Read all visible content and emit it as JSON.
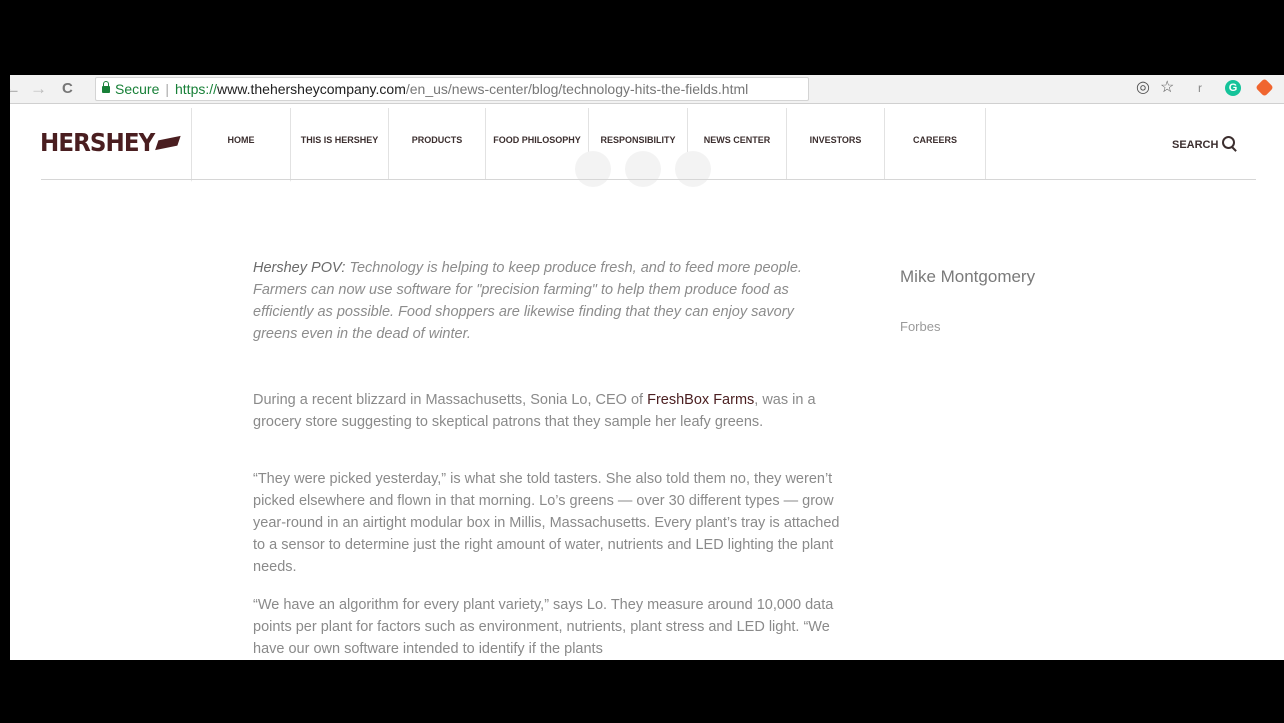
{
  "browser": {
    "back_icon": "←",
    "forward_icon": "→",
    "reload_icon": "C",
    "secure_label": "Secure",
    "url_scheme": "https://",
    "url_domain": "www.thehersheycompany.com",
    "url_path": "/en_us/news-center/blog/technology-hits-the-fields.html",
    "ext_user_initial": "r",
    "ext_grammarly": "G"
  },
  "site": {
    "logo_text": "HERSHEY",
    "nav": [
      "HOME",
      "THIS IS HERSHEY",
      "PRODUCTS",
      "FOOD PHILOSOPHY",
      "RESPONSIBILITY",
      "NEWS CENTER",
      "INVESTORS",
      "CAREERS"
    ],
    "search_label": "SEARCH"
  },
  "article": {
    "pov_label": "Hershey POV:",
    "pov_text": " Technology is helping to keep produce fresh, and to feed more people. Farmers can now use software for \"precision farming\" to help them produce food as efficiently as possible. Food shoppers are likewise finding that they can enjoy savory greens even in the dead of winter.",
    "p1_before": "During a recent blizzard in Massachusetts, Sonia Lo, CEO of ",
    "p1_link": "FreshBox Farms",
    "p1_after": ", was in a grocery store suggesting to skeptical patrons that they sample her leafy greens.",
    "p2": "“They were picked yesterday,” is what she told tasters. She also told them no, they weren’t picked elsewhere and flown in that morning. Lo’s greens — over 30 different types — grow year-round in an airtight modular box in Millis, Massachusetts. Every plant’s tray is attached to a sensor to determine just the right amount of water, nutrients and LED lighting the plant needs.",
    "p3": "“We have an algorithm for every plant variety,” says Lo. They measure around 10,000 data points per plant for factors such as environment, nutrients, plant stress and LED light. “We have our own software intended to identify if the plants"
  },
  "author": {
    "name": "Mike Montgomery",
    "source": "Forbes"
  },
  "colors": {
    "brand": "#4a1e20",
    "secure_green": "#188038",
    "grammarly": "#15c39a",
    "extension_orange": "#f0652f"
  }
}
